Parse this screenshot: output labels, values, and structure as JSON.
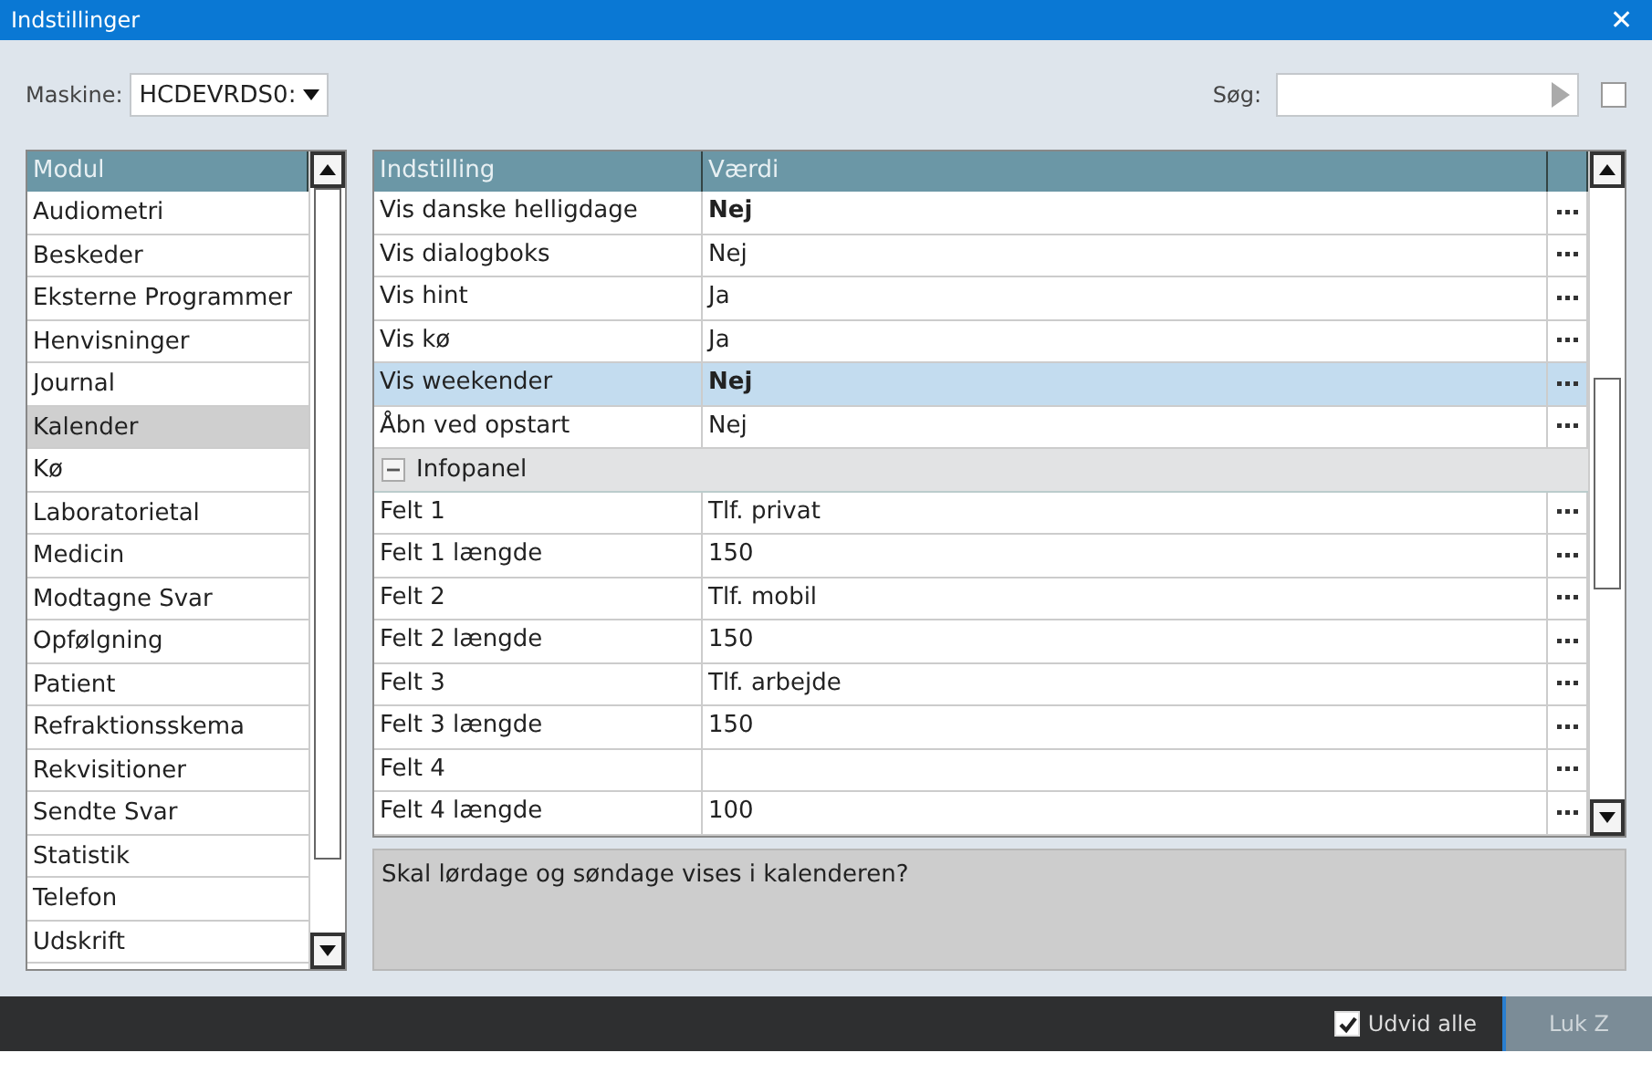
{
  "window": {
    "title": "Indstillinger",
    "close": "✕"
  },
  "machine": {
    "label": "Maskine:",
    "value": "HCDEVRDS0:"
  },
  "search": {
    "label": "Søg:",
    "checked": false
  },
  "modules": {
    "column": "Modul",
    "items": [
      {
        "label": "Audiometri",
        "selected": false
      },
      {
        "label": "Beskeder",
        "selected": false
      },
      {
        "label": "Eksterne Programmer",
        "selected": false
      },
      {
        "label": "Henvisninger",
        "selected": false
      },
      {
        "label": "Journal",
        "selected": false
      },
      {
        "label": "Kalender",
        "selected": true
      },
      {
        "label": "Kø",
        "selected": false
      },
      {
        "label": "Laboratorietal",
        "selected": false
      },
      {
        "label": "Medicin",
        "selected": false
      },
      {
        "label": "Modtagne Svar",
        "selected": false
      },
      {
        "label": "Opfølgning",
        "selected": false
      },
      {
        "label": "Patient",
        "selected": false
      },
      {
        "label": "Refraktionsskema",
        "selected": false
      },
      {
        "label": "Rekvisitioner",
        "selected": false
      },
      {
        "label": "Sendte Svar",
        "selected": false
      },
      {
        "label": "Statistik",
        "selected": false
      },
      {
        "label": "Telefon",
        "selected": false
      },
      {
        "label": "Udskrift",
        "selected": false
      }
    ]
  },
  "settings": {
    "columns": [
      "Indstilling",
      "Værdi"
    ],
    "rows": [
      {
        "kind": "setting",
        "name": "Vis danske helligdage",
        "value": "Nej",
        "modified": true,
        "selected": false
      },
      {
        "kind": "setting",
        "name": "Vis dialogboks",
        "value": "Nej",
        "modified": false,
        "selected": false
      },
      {
        "kind": "setting",
        "name": "Vis hint",
        "value": "Ja",
        "modified": false,
        "selected": false
      },
      {
        "kind": "setting",
        "name": "Vis kø",
        "value": "Ja",
        "modified": false,
        "selected": false
      },
      {
        "kind": "setting",
        "name": "Vis weekender",
        "value": "Nej",
        "modified": true,
        "selected": true
      },
      {
        "kind": "setting",
        "name": "Åbn ved opstart",
        "value": "Nej",
        "modified": false,
        "selected": false
      },
      {
        "kind": "group",
        "name": "Infopanel",
        "expanded": true
      },
      {
        "kind": "setting",
        "name": "Felt 1",
        "value": "Tlf. privat",
        "modified": false,
        "selected": false
      },
      {
        "kind": "setting",
        "name": "Felt 1 længde",
        "value": "150",
        "modified": false,
        "selected": false
      },
      {
        "kind": "setting",
        "name": "Felt 2",
        "value": "Tlf. mobil",
        "modified": false,
        "selected": false
      },
      {
        "kind": "setting",
        "name": "Felt 2 længde",
        "value": "150",
        "modified": false,
        "selected": false
      },
      {
        "kind": "setting",
        "name": "Felt 3",
        "value": "Tlf. arbejde",
        "modified": false,
        "selected": false
      },
      {
        "kind": "setting",
        "name": "Felt 3 længde",
        "value": "150",
        "modified": false,
        "selected": false
      },
      {
        "kind": "setting",
        "name": "Felt 4",
        "value": "",
        "selected": false
      },
      {
        "kind": "setting",
        "name": "Felt 4 længde",
        "value": "100",
        "modified": false,
        "selected": false
      }
    ]
  },
  "description": "Skal lørdage og søndage vises i kalenderen?",
  "footer": {
    "expand_all": {
      "label": "Udvid alle",
      "checked": true
    },
    "close_button": "Luk Z"
  }
}
